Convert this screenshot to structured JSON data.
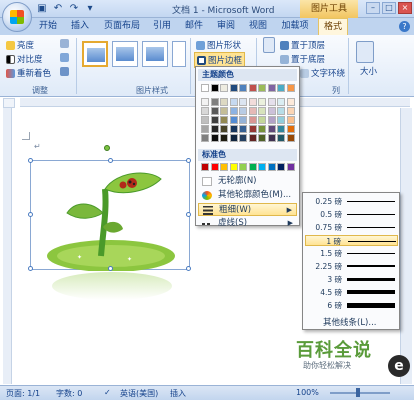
{
  "window": {
    "title": "文档 1 - Microsoft Word",
    "context_tool": "图片工具",
    "controls": [
      "–",
      "□",
      "×"
    ]
  },
  "qat": {
    "icons": [
      "save-icon",
      "undo-icon",
      "redo-icon",
      "customize-icon"
    ],
    "glyphs": [
      "▣",
      "↶",
      "↷",
      "▾"
    ]
  },
  "tabs": {
    "items": [
      "开始",
      "插入",
      "页面布局",
      "引用",
      "邮件",
      "审阅",
      "视图",
      "加载项",
      "格式"
    ],
    "active": "格式",
    "help": "?"
  },
  "ribbon": {
    "adjust": {
      "brightness": "亮度",
      "contrast": "对比度",
      "recolor": "重新着色",
      "label": "调整"
    },
    "styles": {
      "label": "图片样式"
    },
    "shape": "图片形状",
    "border": "图片边框",
    "arrange": {
      "to_front": "置于顶层",
      "to_back": "置于底层",
      "wrap": "文字环绕",
      "label": "列"
    },
    "size": {
      "label": "大小"
    }
  },
  "menu": {
    "theme_colors_header": "主题颜色",
    "standard_colors_header": "标准色",
    "no_outline": "无轮廓(N)",
    "more_colors": "其他轮廓颜色(M)...",
    "weight": "粗细(W)",
    "dashes": "虚线(S)",
    "theme_colors": [
      [
        "#ffffff",
        "#000000",
        "#eeece1",
        "#1f497d",
        "#4f81bd",
        "#c0504d",
        "#9bbb59",
        "#8064a2",
        "#4bacc6",
        "#f79646"
      ],
      [
        "#f2f2f2",
        "#7f7f7f",
        "#ddd9c3",
        "#c6d9f0",
        "#dbe5f1",
        "#f2dcdb",
        "#ebf1dd",
        "#e5e0ec",
        "#dbeef3",
        "#fdeada"
      ],
      [
        "#d8d8d8",
        "#595959",
        "#c4bd97",
        "#8db3e2",
        "#b8cce4",
        "#e5b9b7",
        "#d7e3bc",
        "#ccc1d9",
        "#b7dde8",
        "#fbd5b5"
      ],
      [
        "#bfbfbf",
        "#3f3f3f",
        "#938953",
        "#548dd4",
        "#95b3d7",
        "#d99694",
        "#c3d69b",
        "#b2a2c7",
        "#92cddc",
        "#fac08f"
      ],
      [
        "#a5a5a5",
        "#262626",
        "#494429",
        "#17365d",
        "#366092",
        "#953734",
        "#76923c",
        "#5f497a",
        "#31859b",
        "#e36c09"
      ],
      [
        "#7f7f7f",
        "#0c0c0c",
        "#1d1b10",
        "#0f243e",
        "#244061",
        "#632423",
        "#4f6128",
        "#3f3151",
        "#205867",
        "#974806"
      ]
    ],
    "standard_colors": [
      "#c00000",
      "#ff0000",
      "#ffc000",
      "#ffff00",
      "#92d050",
      "#00b050",
      "#00b0f0",
      "#0070c0",
      "#002060",
      "#7030a0"
    ]
  },
  "weights": {
    "items": [
      {
        "label": "0.25 磅",
        "value": 0.25
      },
      {
        "label": "0.5 磅",
        "value": 0.5
      },
      {
        "label": "0.75 磅",
        "value": 0.75
      },
      {
        "label": "1 磅",
        "value": 1
      },
      {
        "label": "1.5 磅",
        "value": 1.5
      },
      {
        "label": "2.25 磅",
        "value": 2.25
      },
      {
        "label": "3 磅",
        "value": 3
      },
      {
        "label": "4.5 磅",
        "value": 4.5
      },
      {
        "label": "6 磅",
        "value": 6
      }
    ],
    "selected": "1 磅",
    "more": "其他线条(L)..."
  },
  "status": {
    "page": "页面: 1/1",
    "words": "字数: 0",
    "language": "英语(美国)",
    "mode": "插入",
    "zoom": "100%"
  },
  "watermark": {
    "title": "百科全说",
    "subtitle": "助你轻松解决",
    "logo": "e"
  }
}
